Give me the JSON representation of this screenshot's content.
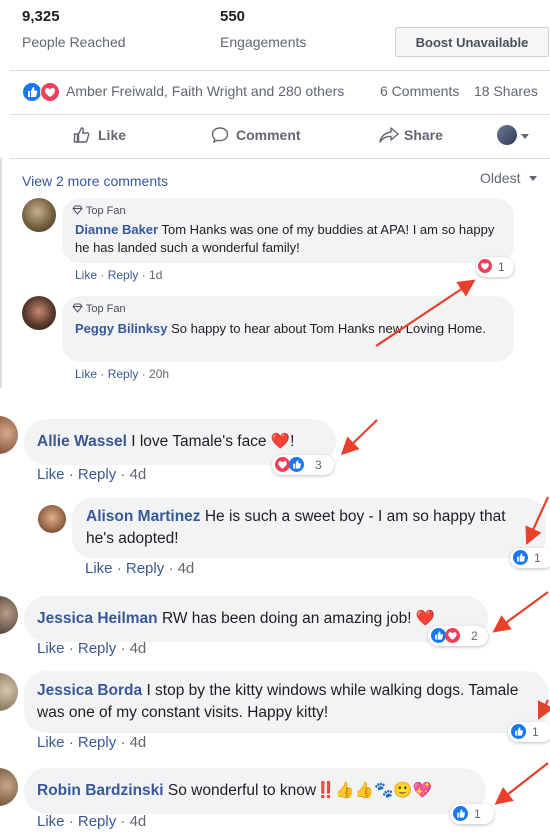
{
  "stats": {
    "reached_value": "9,325",
    "reached_label": "People Reached",
    "engagements_value": "550",
    "engagements_label": "Engagements",
    "boost_label": "Boost Unavailable"
  },
  "reactions": {
    "names": "Amber Freiwald, Faith Wright and 280 others",
    "comments": "6 Comments",
    "shares": "18 Shares"
  },
  "actions": {
    "like": "Like",
    "comment": "Comment",
    "share": "Share"
  },
  "comments_header": {
    "view_more": "View 2 more comments",
    "sort": "Oldest"
  },
  "comments": [
    {
      "badge": "Top Fan",
      "author": "Dianne Baker",
      "text": "Tom Hanks was one of my buddies at APA! I am so happy he has landed such a wonderful family!",
      "like": "Like",
      "reply": "Reply",
      "time": "1d",
      "reaction_count": "1"
    },
    {
      "badge": "Top Fan",
      "author": "Peggy Bilinksy",
      "text": "So happy to hear about Tom Hanks new Loving Home.",
      "like": "Like",
      "reply": "Reply",
      "time": "20h"
    }
  ],
  "comments_lower": [
    {
      "author": "Allie Wassel",
      "text": "I love Tamale's face ❤️!",
      "like": "Like",
      "reply": "Reply",
      "time": "4d",
      "reaction_count": "3"
    },
    {
      "author": "Alison Martinez",
      "text": "He is such a sweet boy - I am so happy that he's adopted!",
      "like": "Like",
      "reply": "Reply",
      "time": "4d",
      "reaction_count": "1"
    },
    {
      "author": "Jessica Heilman",
      "text": "RW has been doing an amazing job! ❤️",
      "like": "Like",
      "reply": "Reply",
      "time": "4d",
      "reaction_count": "2"
    },
    {
      "author": "Jessica Borda",
      "text": "I stop by the kitty windows while walking dogs. Tamale was one of my constant visits. Happy kitty!",
      "like": "Like",
      "reply": "Reply",
      "time": "4d",
      "reaction_count": "1"
    },
    {
      "author": "Robin Bardzinski",
      "text": "So wonderful to know‼️👍👍🐾🙂💖",
      "like": "Like",
      "reply": "Reply",
      "time": "4d",
      "reaction_count": "1"
    }
  ],
  "colors": {
    "link": "#385898",
    "like_blue": "#1877f2",
    "love_red": "#f33e58",
    "arrow_red": "#e8402a"
  }
}
